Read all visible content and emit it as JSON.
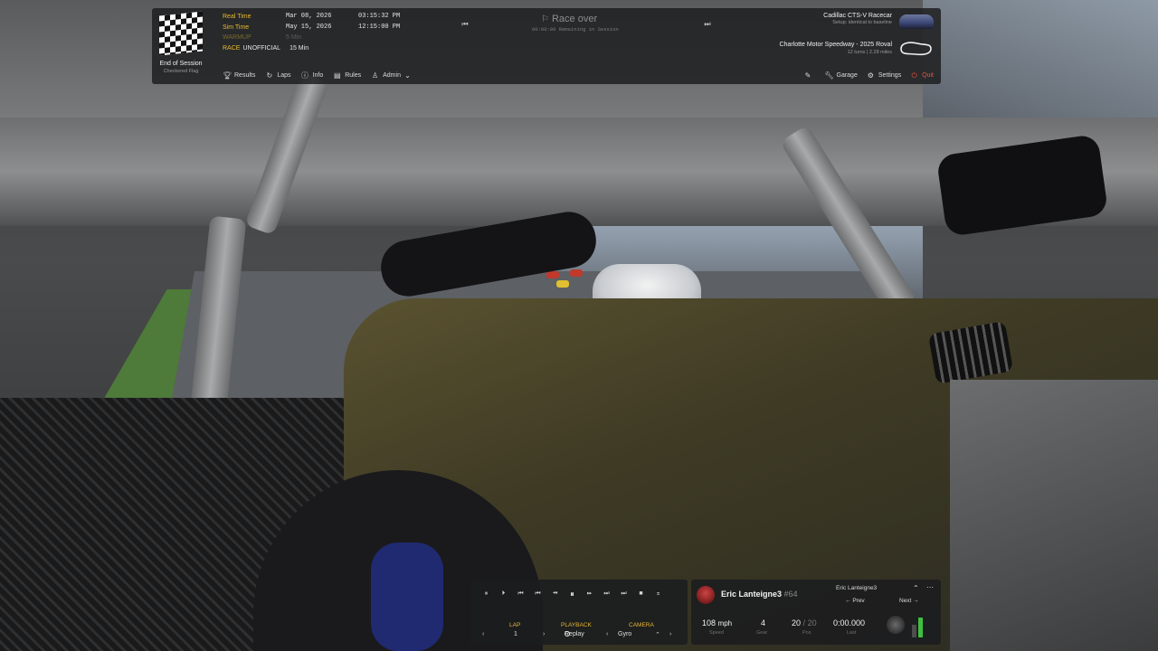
{
  "session": {
    "status": "End of Session",
    "flag": "Checkered Flag",
    "times": [
      {
        "label": "Real Time",
        "date": "Mar 08, 2026",
        "clock": "03:15:32 PM"
      },
      {
        "label": "Sim Time",
        "date": "May 15, 2026",
        "clock": "12:15:00 PM"
      }
    ],
    "warmup": {
      "label": "WARMUP",
      "value": "5 Min"
    },
    "race": {
      "label": "RACE",
      "state": "UNOFFICIAL",
      "value": "15 Min"
    },
    "center_title": "Race over",
    "remaining": "00:00:00 Remaining in Session"
  },
  "car": {
    "name": "Cadillac CTS-V Racecar",
    "setup": "Setup: identical to baseline"
  },
  "track": {
    "name": "Charlotte Motor Speedway - 2025 Roval",
    "detail": "12 turns | 2.28 miles"
  },
  "nav_left": [
    {
      "label": "Results",
      "icon": "trophy-icon"
    },
    {
      "label": "Laps",
      "icon": "laps-icon"
    },
    {
      "label": "Info",
      "icon": "info-icon"
    },
    {
      "label": "Rules",
      "icon": "rules-icon"
    },
    {
      "label": "Admin",
      "icon": "admin-icon"
    }
  ],
  "nav_right": [
    {
      "label": "Garage",
      "icon": "wrench-icon"
    },
    {
      "label": "Settings",
      "icon": "gear-icon"
    },
    {
      "label": "Quit",
      "icon": "power-icon"
    }
  ],
  "playback": {
    "lap_label": "LAP",
    "lap_value": "1",
    "playback_label": "PLAYBACK",
    "playback_value": "Replay",
    "camera_label": "CAMERA",
    "camera_value": "Gyro"
  },
  "driver": {
    "name": "Eric Lanteigne3",
    "number": "#64",
    "following": "Eric Lanteigne3",
    "prev_label": "Prev",
    "next_label": "Next",
    "speed": "108",
    "speed_unit": "mph",
    "speed_label": "Speed",
    "gear": "4",
    "gear_label": "Gear",
    "pos": "20",
    "pos_total": "20",
    "pos_label": "Pos",
    "last": "0:00.000",
    "last_label": "Last"
  },
  "colors": {
    "accent": "#e8b931",
    "quit": "#e2553f",
    "level_green": "#3fbf3f"
  }
}
